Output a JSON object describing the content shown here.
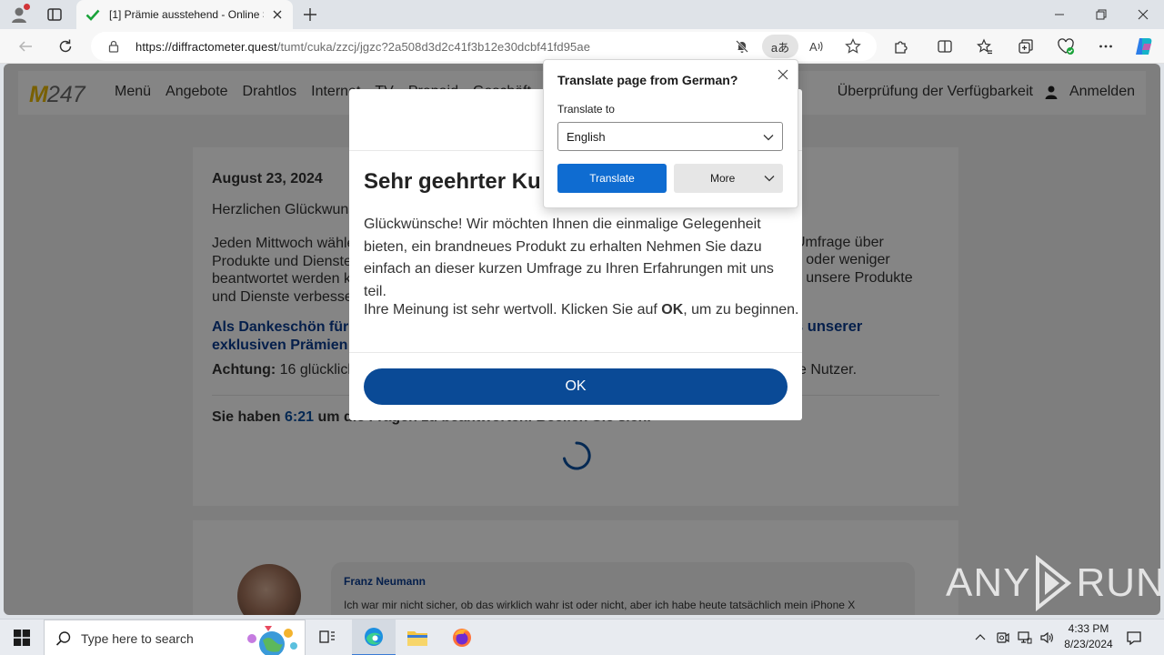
{
  "browser": {
    "tab_title": "[1] Prämie ausstehend - Online Sh",
    "url_host": "https://diffractometer.quest",
    "url_path": "/tumt/cuka/zzcj/jgzc?2a508d3d2c41f3b12e30dcbf41fd95ae",
    "translate_pill": "aあ"
  },
  "site": {
    "logo_m": "M",
    "logo_num": "247",
    "menu": [
      "Menü",
      "Angebote",
      "Drahtlos",
      "Internet",
      "TV",
      "Prepaid",
      "Geschäft"
    ],
    "availability": "Überprüfung der Verfügbarkeit",
    "login": "Anmelden"
  },
  "article": {
    "date": "August 23, 2024",
    "greeting": "Herzlichen Glückwuns",
    "paragraph_left": "Jeden Mittwoch wähle",
    "paragraph_left2": "Produkte und Dienste",
    "paragraph_left3": "beantwortet werden ke",
    "paragraph_left4": "und Dienste verbesse",
    "paragraph_right1": "Umfrage über",
    "paragraph_right2": "en oder weniger",
    "paragraph_right3": "nd unsere Produkte",
    "thanks_left": "Als Dankeschön für",
    "thanks_left2": "exklusiven Prämien",
    "thanks_right": "s unserer",
    "achtung_label": "Achtung:",
    "achtung_text": "16 glücklich",
    "achtung_right": "e Nutzer.",
    "timer_prefix": "Sie haben",
    "timer_value": "6:21",
    "timer_suffix": "um die Fragen zu beantworten. Beeilen Sie sich."
  },
  "comment": {
    "name": "Franz Neumann",
    "text": "Ich war mir nicht sicher, ob das wirklich wahr ist oder nicht, aber ich habe heute tatsächlich mein iPhone X"
  },
  "modal": {
    "title": "Sehr geehrter Ku",
    "body": "Glückwünsche! Wir möchten Ihnen die einmalige Gelegenheit bieten, ein brandneues Produkt zu erhalten Nehmen Sie dazu einfach an dieser kurzen Umfrage zu Ihren Erfahrungen mit uns teil.",
    "body2_prefix": "Ihre Meinung ist sehr wertvoll. Klicken Sie auf",
    "body2_bold": "OK",
    "body2_suffix": ", um zu beginnen.",
    "ok_label": "OK"
  },
  "translate_popup": {
    "title": "Translate page from German?",
    "label": "Translate to",
    "selected_language": "English",
    "translate_button": "Translate",
    "more_button": "More"
  },
  "watermark": {
    "text_left": "ANY",
    "text_right": "RUN"
  },
  "taskbar": {
    "search_placeholder": "Type here to search",
    "time": "4:33 PM",
    "date": "8/23/2024"
  },
  "colors": {
    "accent": "#0f6cd1",
    "modal_button": "#0a4a96",
    "link_blue": "#0a3d91",
    "logo_yellow": "#e8b800"
  }
}
